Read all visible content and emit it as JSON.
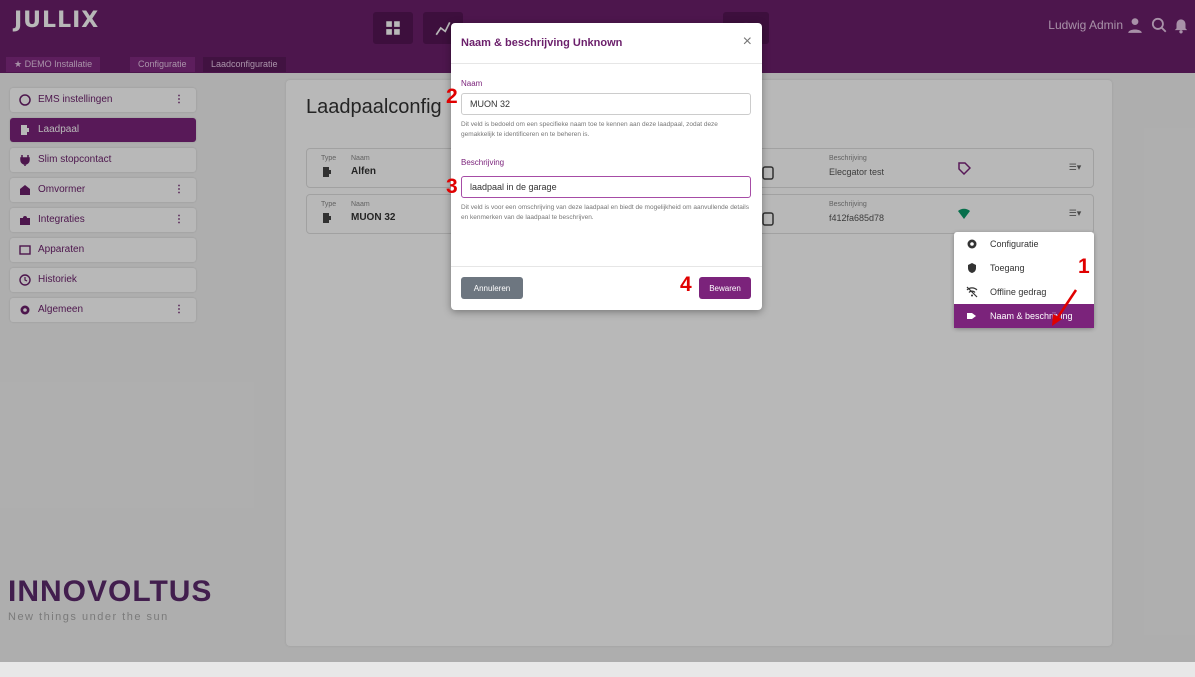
{
  "header": {
    "logo": "JULLIX",
    "user": "Ludwig Admin",
    "nav_icons": [
      "dashboard-icon",
      "chart-icon",
      "globe-icon",
      "bolt-icon",
      "document-icon",
      "grid-icon",
      "gear-icon"
    ]
  },
  "breadcrumb": [
    "DEMO Installatie",
    "Configuratie",
    "Laadconfiguratie"
  ],
  "sidebar": {
    "items": [
      {
        "label": "EMS instellingen",
        "icon": "ems-icon",
        "more": true
      },
      {
        "label": "Laadpaal",
        "icon": "charger-icon",
        "active": true
      },
      {
        "label": "Slim stopcontact",
        "icon": "plug-icon"
      },
      {
        "label": "Omvormer",
        "icon": "inverter-icon",
        "more": true
      },
      {
        "label": "Integraties",
        "icon": "puzzle-icon",
        "more": true
      },
      {
        "label": "Apparaten",
        "icon": "devices-icon"
      },
      {
        "label": "Historiek",
        "icon": "history-icon"
      },
      {
        "label": "Algemeen",
        "icon": "gear-icon",
        "more": true
      }
    ],
    "brand": "INNOVOLTUS",
    "brand_tagline": "New things under the sun"
  },
  "main": {
    "title": "Laadpaalconfig",
    "subtitle": "",
    "link": "",
    "headers": {
      "type": "Type",
      "name": "Naam",
      "connection": "",
      "description": "Beschrijving"
    },
    "rows": [
      {
        "name": "Alfen",
        "description": "Elecgator test"
      },
      {
        "name": "MUON 32",
        "description": "f412fa685d78"
      }
    ]
  },
  "footer": {
    "link": ""
  },
  "dropdown": {
    "items": [
      {
        "label": "Configuratie",
        "icon": "gear-icon"
      },
      {
        "label": "Toegang",
        "icon": "shield-icon"
      },
      {
        "label": "Offline gedrag",
        "icon": "wifi-off-icon"
      },
      {
        "label": "Naam & beschrijving",
        "icon": "rename-icon",
        "active": true
      }
    ]
  },
  "modal": {
    "title": "Naam & beschrijving Unknown",
    "close": "×",
    "name_label": "Naam",
    "name_value": "MUON 32",
    "name_help": "Dit veld is bedoeld om een specifieke naam toe te kennen aan deze laadpaal, zodat deze gemakkelijk te identificeren en te beheren is.",
    "desc_label": "Beschrijving",
    "desc_value": "laadpaal in de garage",
    "desc_help": "Dit veld is voor een omschrijving van deze laadpaal en biedt de mogelijkheid om aanvullende details en kenmerken van de laadpaal te beschrijven.",
    "cancel": "Annuleren",
    "save": "Bewaren"
  },
  "annotations": {
    "step1": "1",
    "step2": "2",
    "step3": "3",
    "step4": "4"
  },
  "colors": {
    "brand": "#6b1f6b",
    "accent": "#7b237b",
    "annotation": "#e00000"
  }
}
